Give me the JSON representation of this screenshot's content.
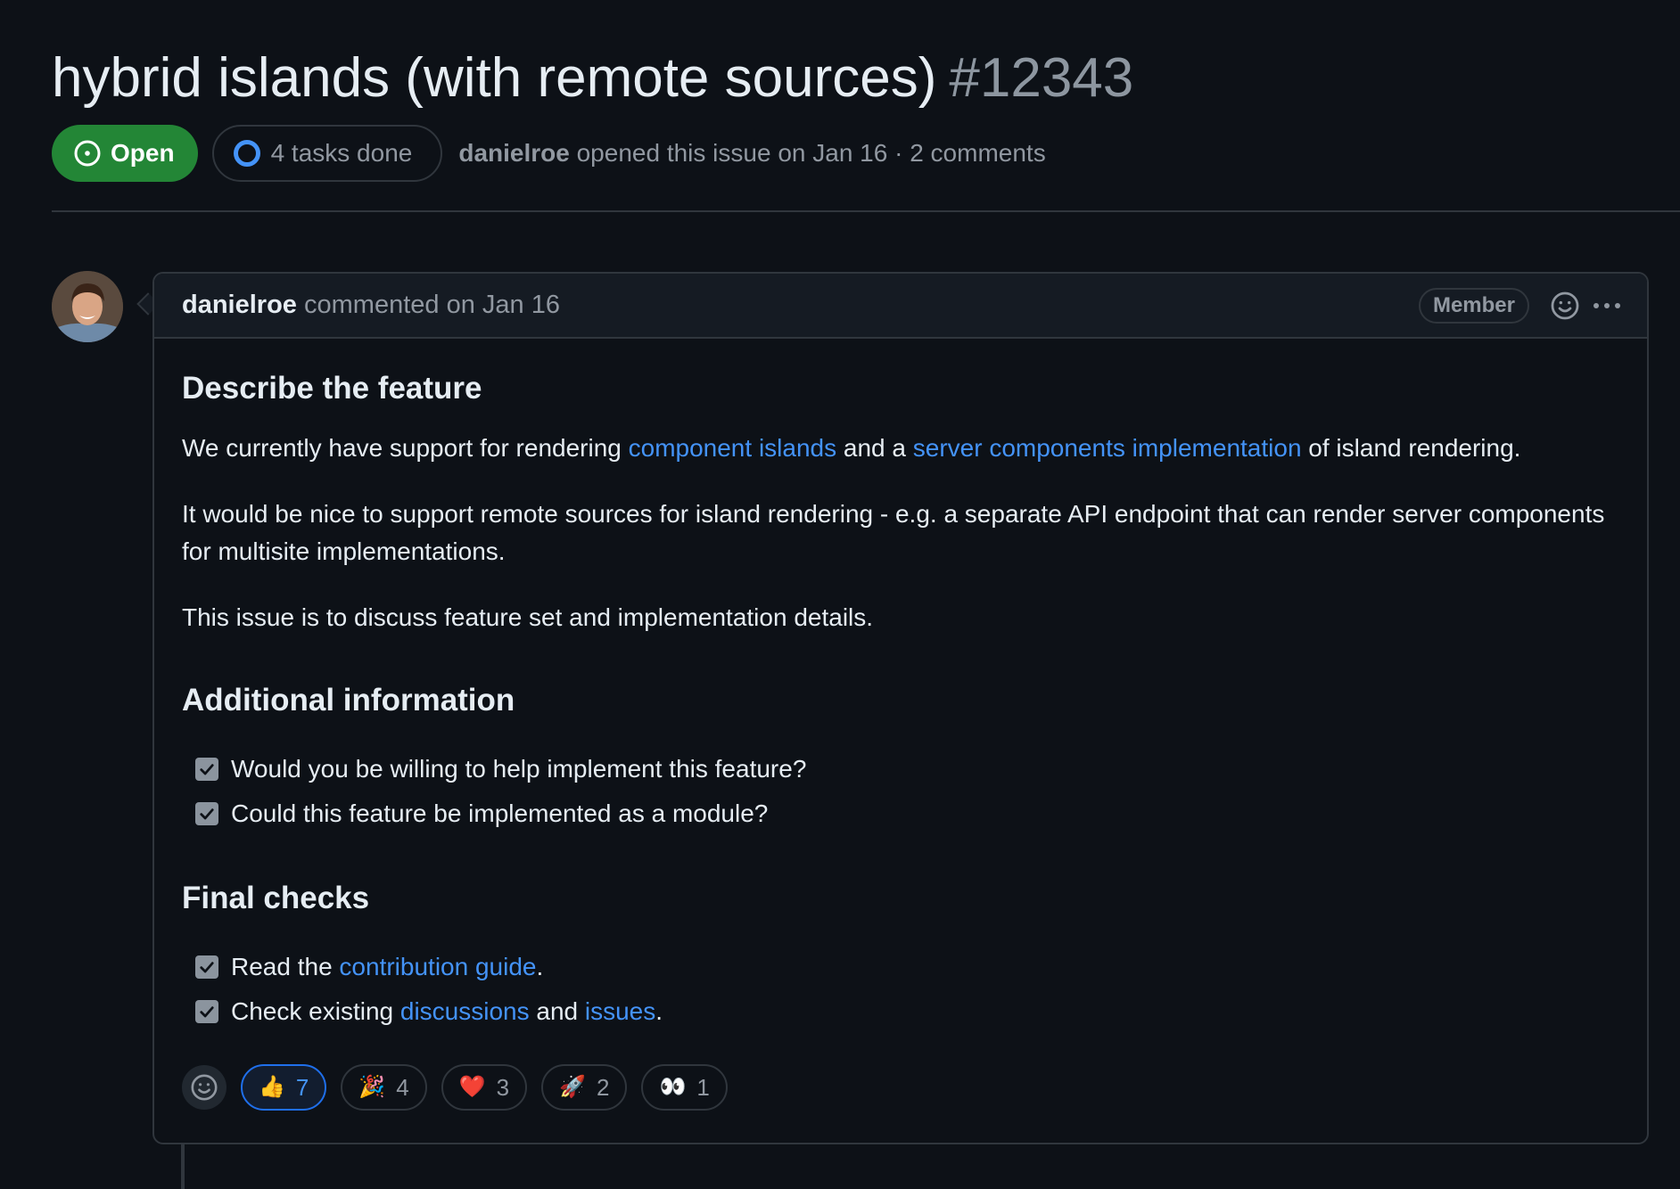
{
  "issue": {
    "title": "hybrid islands (with remote sources)",
    "number": "#12343",
    "state": "Open",
    "tasks": "4 tasks done",
    "author": "danielroe",
    "meta_rest": "opened this issue on Jan 16 · 2 comments"
  },
  "comment": {
    "author": "danielroe",
    "date_text": "commented on Jan 16",
    "role": "Member",
    "sections": {
      "feature_heading": "Describe the feature",
      "p1": {
        "t1": "We currently have support for rendering ",
        "link1": "component islands",
        "t2": " and a ",
        "link2": "server components implementation",
        "t3": " of island rendering."
      },
      "p2": "It would be nice to support remote sources for island rendering - e.g. a separate API endpoint that can render server components for multisite implementations.",
      "p3": "This issue is to discuss feature set and implementation details.",
      "additional_heading": "Additional information",
      "additional_items": [
        "Would you be willing to help implement this feature?",
        "Could this feature be implemented as a module?"
      ],
      "final_heading": "Final checks",
      "final_1": {
        "t1": "Read the ",
        "link": "contribution guide",
        "t2": "."
      },
      "final_2": {
        "t1": "Check existing ",
        "link1": "discussions",
        "t2": " and ",
        "link2": "issues",
        "t3": "."
      }
    }
  },
  "reactions": [
    {
      "emoji": "👍",
      "count": "7",
      "active": true
    },
    {
      "emoji": "🎉",
      "count": "4",
      "active": false
    },
    {
      "emoji": "❤️",
      "count": "3",
      "active": false
    },
    {
      "emoji": "🚀",
      "count": "2",
      "active": false
    },
    {
      "emoji": "👀",
      "count": "1",
      "active": false
    }
  ],
  "colors": {
    "background": "#0d1117",
    "open_green": "#238636",
    "link_blue": "#4493f8",
    "border": "#30363d",
    "muted": "#9198a1"
  }
}
